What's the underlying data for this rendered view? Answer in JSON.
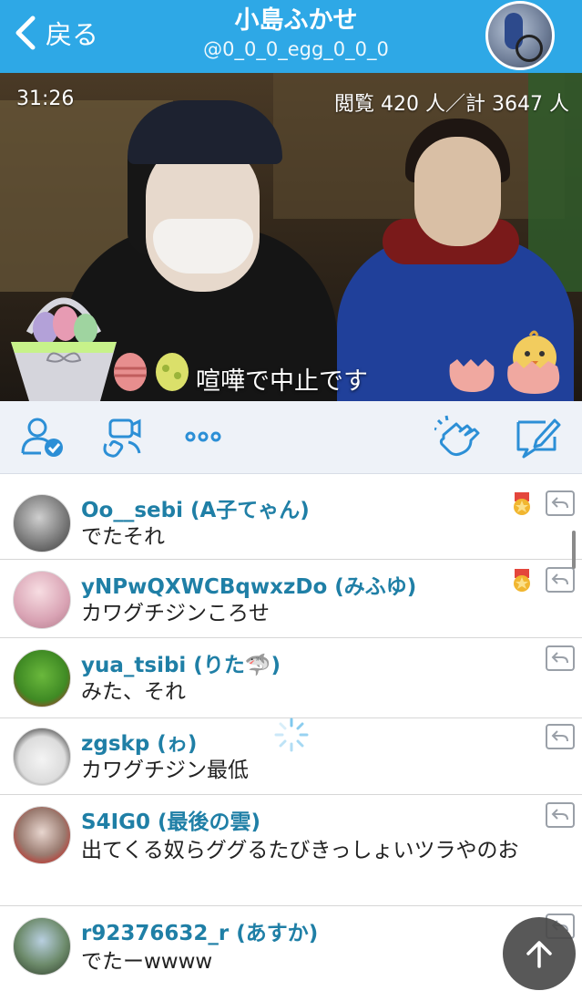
{
  "header": {
    "back_label": "戻る",
    "title": "小島ふかせ",
    "handle": "@0_0_0_egg_0_0_0"
  },
  "stream": {
    "elapsed": "31:26",
    "viewers": "閲覧 420 人／計 3647 人",
    "caption": "喧嘩で中止です"
  },
  "toolbar": {
    "icons": [
      "follow-user-icon",
      "video-call-icon",
      "more-icon",
      "applause-icon",
      "compose-comment-icon"
    ]
  },
  "comments": [
    {
      "name": "Oo__sebi (A子てゃん)",
      "text": "でたそれ",
      "badge": true
    },
    {
      "name": "yNPwQXWCBqwxzDo (みふゆ)",
      "text": "カワグチジンころせ",
      "badge": true
    },
    {
      "name": "yua_tsibi (りた🦈)",
      "text": "みた、それ",
      "badge": false
    },
    {
      "name": "zgskp (ゎ)",
      "text": "カワグチジン最低",
      "badge": false
    },
    {
      "name": "S4IG0 (最後の雲)",
      "text": "出てくる奴らググるたびきっしょいツラやのお",
      "badge": false
    },
    {
      "name": "r92376632_r (あすか)",
      "text": "でたーwwww",
      "badge": false
    }
  ],
  "colors": {
    "header_bg": "#2ea8e6",
    "accent": "#2c8fd6",
    "username": "#1f7fa6"
  }
}
